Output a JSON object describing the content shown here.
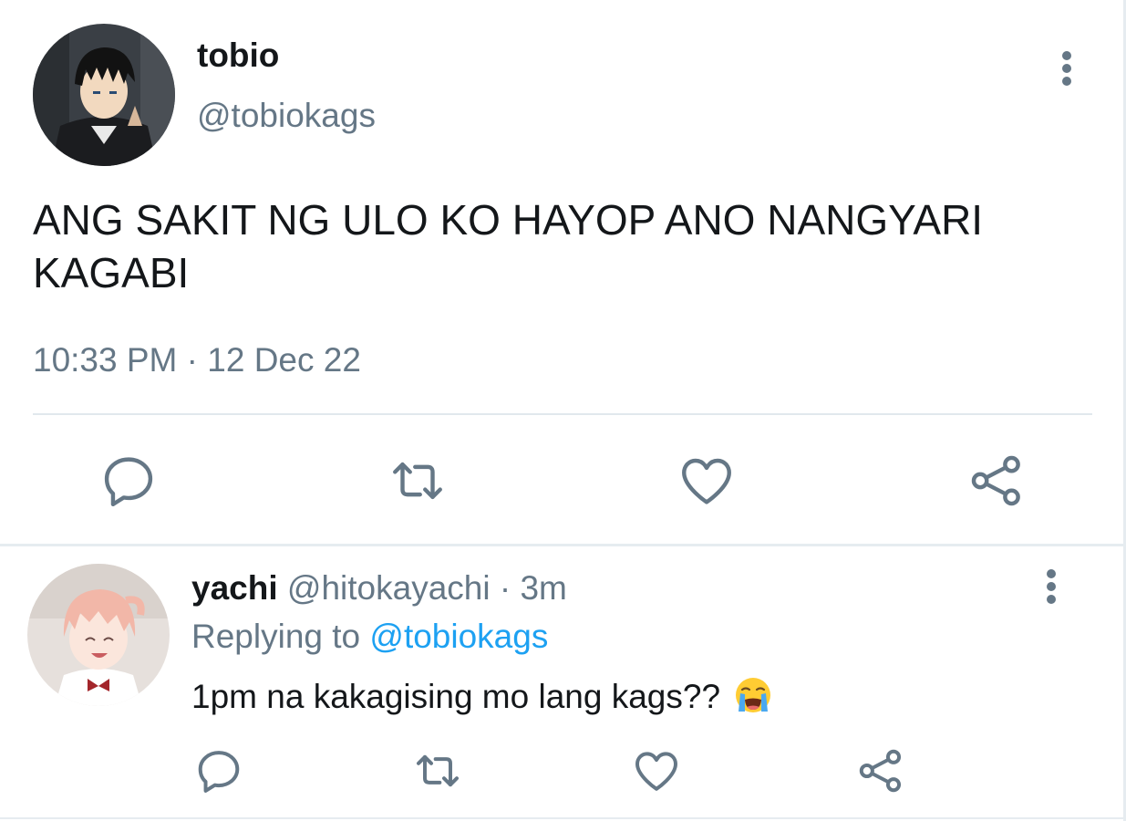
{
  "main_tweet": {
    "author_name": "tobio",
    "author_handle": "@tobiokags",
    "text": "ANG SAKIT NG ULO KO HAYOP ANO NANGYARI KAGABI",
    "time": "10:33 PM",
    "separator": "·",
    "date": "12 Dec 22",
    "actions": [
      "reply-icon",
      "retweet-icon",
      "like-icon",
      "share-icon"
    ]
  },
  "reply_tweet": {
    "author_name": "yachi",
    "author_handle": "@hitokayachi",
    "separator": "·",
    "age": "3m",
    "replying_to_label": "Replying to",
    "replying_to_handle": "@tobiokags",
    "text": "1pm na kakagising mo lang kags??",
    "emoji": "loudly-crying-face",
    "actions": [
      "reply-icon",
      "retweet-icon",
      "like-icon",
      "share-icon"
    ]
  },
  "colors": {
    "text_primary": "#14171a",
    "text_secondary": "#657786",
    "accent": "#1da1f2",
    "divider": "#e1e8ed"
  }
}
